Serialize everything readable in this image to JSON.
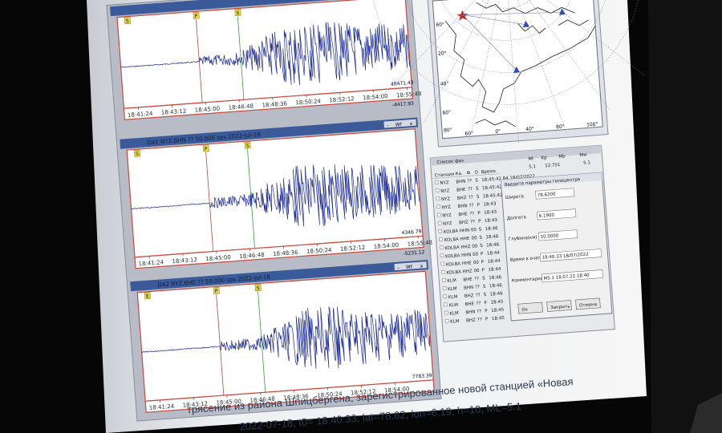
{
  "panels": [
    {
      "id": "top",
      "title": "",
      "phase_markers": [
        "S",
        "P",
        "S"
      ],
      "amplitude_label": "48471.43",
      "amplitude_label_2": "-4417.93",
      "time_ticks": [
        "18:41:24",
        "18:43:12",
        "18:45:00",
        "18:46:48",
        "18:48:36",
        "18:50:24",
        "18:52:12",
        "18:54:00",
        "18:55:48"
      ]
    },
    {
      "id": "mid",
      "title": "D41  NYZ.BHN ?? 50.000 sps 2022-Jul-18",
      "phase_markers": [
        "S",
        "P",
        "S"
      ],
      "amplitude_label": "4346.79",
      "amplitude_label_2": "-5231.12",
      "time_ticks": [
        "18:41:24",
        "18:43:12",
        "18:45:00",
        "18:46:48",
        "18:48:36",
        "18:50:24",
        "18:52:12",
        "18:54:00",
        "18:55:48"
      ]
    },
    {
      "id": "bot",
      "title": "D42  NYZ.BHE ?? 50.000 sps 2022-Jul-18",
      "phase_markers": [
        "E",
        "P",
        "S"
      ],
      "amplitude_label": "7783.39",
      "time_ticks": [
        "18:41:24",
        "18:43:12",
        "18:45:00",
        "18:46:48",
        "18:48:36",
        "18:50:24",
        "18:52:12",
        "18:54:00"
      ]
    }
  ],
  "panel_controls": {
    "minimize": "–",
    "wf": "Wf",
    "close": "x"
  },
  "map": {
    "lat_labels": [
      "60°",
      "20°",
      "40°",
      "60°",
      "80°"
    ],
    "lon_labels": [
      "60°",
      "0°",
      "40°",
      "80°",
      "100°"
    ]
  },
  "table_window": {
    "title": "Список фаз",
    "headers": [
      "Станция",
      "Ка.",
      "Ф",
      "О",
      "Время"
    ],
    "rows": [
      [
        "NYZ",
        "BHN",
        "??",
        "S",
        "18:45:42.84 18/07/2022"
      ],
      [
        "NYZ",
        "BHE",
        "??",
        "S",
        "18:45:42.84 18/07/2022"
      ],
      [
        "NYZ",
        "BHZ",
        "??",
        "S",
        "18:45:42.84 18/07/2022"
      ],
      [
        "NYZ",
        "BHN",
        "??",
        "P",
        "18:43"
      ],
      [
        "NYZ",
        "BHE",
        "??",
        "P",
        "18:43"
      ],
      [
        "NYZ",
        "BHZ",
        "??",
        "P",
        "18:43"
      ],
      [
        "KOLBA",
        "HHN",
        "00",
        "S",
        "18:46"
      ],
      [
        "KOLBA",
        "HHE",
        "00",
        "S",
        "18:46"
      ],
      [
        "KOLBA",
        "HHZ",
        "00",
        "S",
        "18:46"
      ],
      [
        "KOLBA",
        "HHN",
        "00",
        "P",
        "18:44"
      ],
      [
        "KOLBA",
        "HHE",
        "00",
        "P",
        "18:44"
      ],
      [
        "KOLBA",
        "HHZ",
        "00",
        "P",
        "18:44"
      ],
      [
        "KLM",
        "BHE",
        "??",
        "S",
        "18:46"
      ],
      [
        "KLM",
        "BHN",
        "??",
        "S",
        "18:46"
      ],
      [
        "KLM",
        "BHZ",
        "??",
        "S",
        "18:46"
      ],
      [
        "KLM",
        "BHE",
        "??",
        "P",
        "18:45"
      ],
      [
        "KLM",
        "BHN",
        "??",
        "P",
        "18:45"
      ],
      [
        "KLM",
        "BHZ",
        "??",
        "P",
        "18:45"
      ]
    ],
    "right_headers": [
      "Ml",
      "Kp",
      "Mb",
      "Mw"
    ],
    "right_values": [
      "5.1",
      "12.751",
      "5.1"
    ]
  },
  "hypocenter_dialog": {
    "title": "Введите параметры гипоцентра",
    "fields": [
      {
        "label": "Широта",
        "value": "78.6200"
      },
      {
        "label": "Долгота",
        "value": "6.1900"
      },
      {
        "label": "Глубина(км)",
        "value": "10.0000"
      },
      {
        "label": "Время в очаге",
        "value": "18:40:33 18/07/2022"
      },
      {
        "label": "Комментарий",
        "value": "M5.1 18.07.22 18:40"
      }
    ],
    "buttons": [
      "Ок",
      "Закрыть",
      "Отмена"
    ]
  },
  "caption": {
    "line1": "трясение из района Шпицбергена, зарегистрированное новой станцией «Новая",
    "line2": "2022-07-18, t0= 18:40:33, lat=78.62, lon=6.19, h=10, ML=5.1"
  },
  "colors": {
    "trace": "#1a2a9a",
    "panel_frame": "#c9493a",
    "bar": "#3a5a9a",
    "station": "#2a4ac8",
    "epicenter": "#d22222",
    "pick_line_P": "#b24a3a",
    "pick_line_S": "#3aa03a"
  }
}
